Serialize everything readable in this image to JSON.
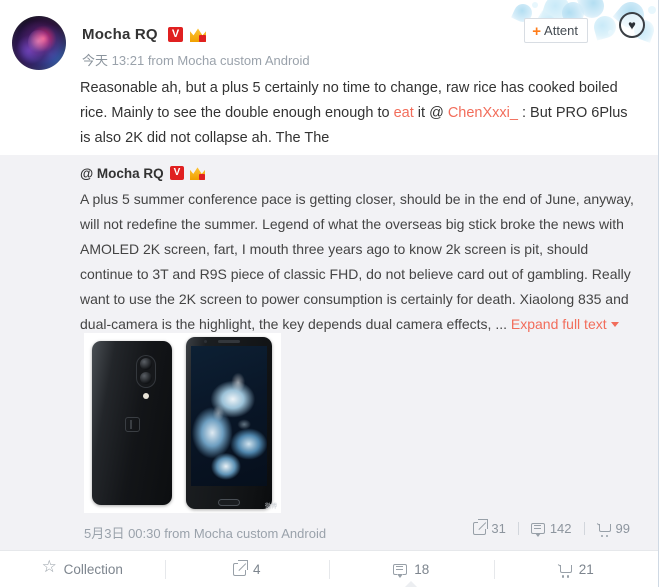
{
  "header": {
    "username": "Mocha RQ",
    "verified_badge": "V",
    "vip_badge": "crown-badge",
    "time_day": "今天",
    "time_clock": "13:21",
    "source": "from Mocha custom Android",
    "attend_label": "Attent",
    "attend_plus": "+",
    "heart_icon": "♥"
  },
  "post": {
    "text_part1": "Reasonable ah, but a plus 5 certainly no time to change, raw rice has cooked boiled rice. Mainly to see the double enough enough to ",
    "link_eat": "eat",
    "text_part2": " it @ ",
    "link_mention": "ChenXxxi_",
    "text_part3": " : But PRO 6Plus is also 2K did not collapse ah. The The"
  },
  "quote": {
    "at_user": "@ Mocha RQ",
    "verified_badge": "V",
    "vip_badge": "crown-badge",
    "body": "A plus 5 summer conference pace is getting closer, should be in the end of June, anyway, will not redefine the summer. Legend of what the overseas big stick broke the news with AMOLED 2K screen, fart, I mouth three years ago to know 2k screen is pit, should continue to 3T and R9S piece of classic FHD, do not believe card out of gambling. Really want to use the 2K screen to power consumption is certainly for death. Xiaolong 835 and dual-camera is the highlight, the key depends dual camera effects, ... ",
    "expand_label": "Expand full text",
    "image_watermark": "微博",
    "date": "5月3日 00:30 from Mocha custom Android",
    "stats": [
      {
        "icon": "share-icon",
        "count": "31"
      },
      {
        "icon": "comment-icon",
        "count": "142"
      },
      {
        "icon": "cart-icon",
        "count": "99"
      }
    ]
  },
  "actionbar": [
    {
      "icon": "star-icon",
      "label": "Collection"
    },
    {
      "icon": "share-icon",
      "label": "4"
    },
    {
      "icon": "comment-icon",
      "label": "18"
    },
    {
      "icon": "cart-icon",
      "label": "21"
    }
  ],
  "colors": {
    "link": "#f26d5b",
    "accent_orange": "#ff7d1a",
    "badge_red": "#e02020",
    "quote_bg": "#f2f2f5",
    "text": "#333333",
    "muted": "#9aa2ab"
  }
}
